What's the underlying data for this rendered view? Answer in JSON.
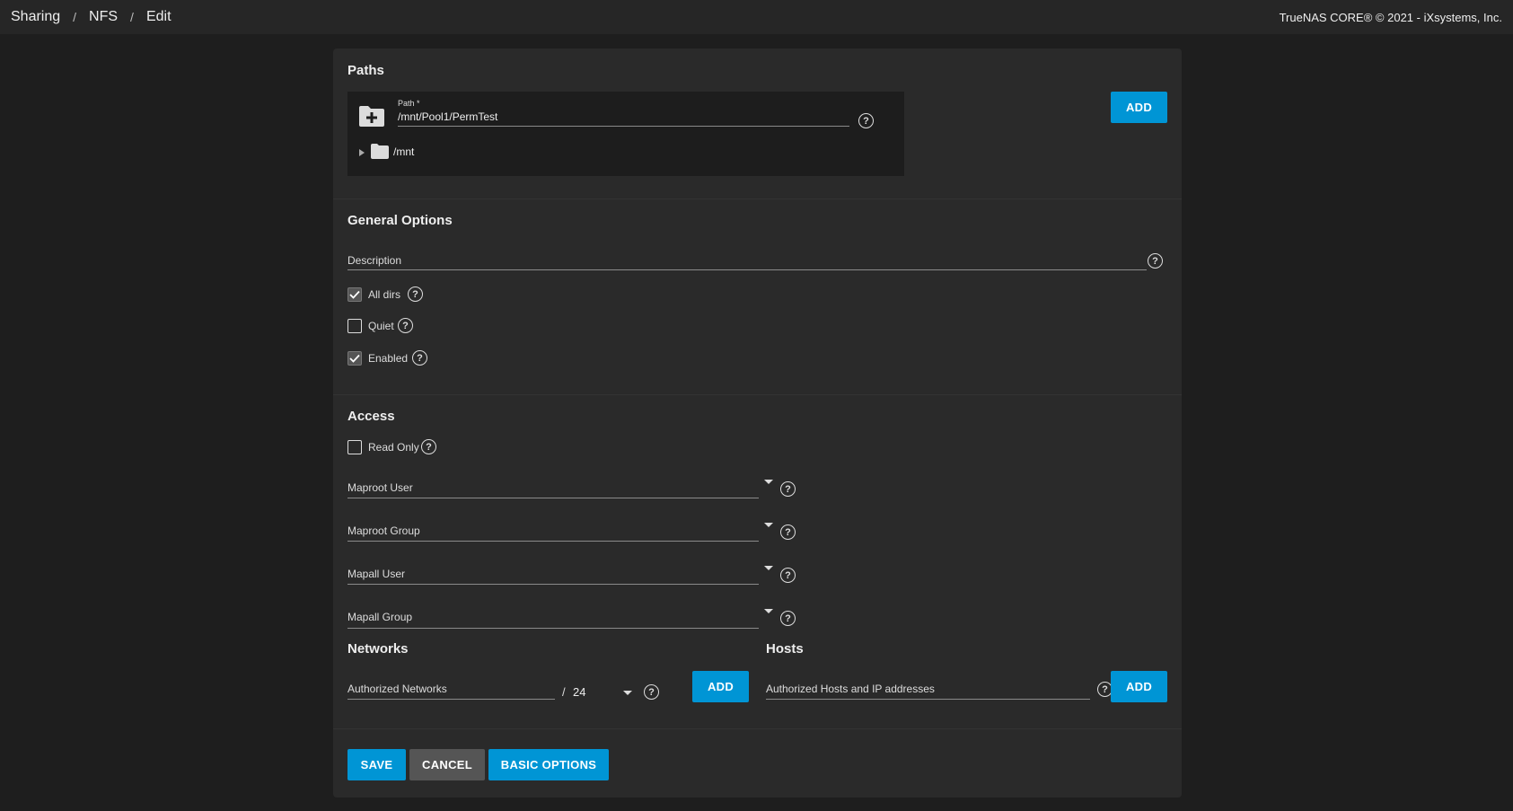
{
  "breadcrumb": {
    "items": [
      "Sharing",
      "NFS",
      "Edit"
    ],
    "separator": "/"
  },
  "copyright": "TrueNAS CORE® © 2021 - iXsystems, Inc.",
  "paths": {
    "title": "Paths",
    "path_label": "Path *",
    "path_value": "/mnt/Pool1/PermTest",
    "tree_root": "/mnt",
    "add_label": "ADD"
  },
  "general": {
    "title": "General Options",
    "description_label": "Description",
    "all_dirs_label": "All dirs",
    "all_dirs_checked": true,
    "quiet_label": "Quiet",
    "quiet_checked": false,
    "enabled_label": "Enabled",
    "enabled_checked": true
  },
  "access": {
    "title": "Access",
    "read_only_label": "Read Only",
    "read_only_checked": false,
    "maproot_user_label": "Maproot User",
    "maproot_group_label": "Maproot Group",
    "mapall_user_label": "Mapall User",
    "mapall_group_label": "Mapall Group"
  },
  "networks": {
    "title": "Networks",
    "field_label": "Authorized Networks",
    "slash": "/",
    "netmask": "24",
    "add_label": "ADD"
  },
  "hosts": {
    "title": "Hosts",
    "field_label": "Authorized Hosts and IP addresses",
    "add_label": "ADD"
  },
  "actions": {
    "save_label": "SAVE",
    "cancel_label": "CANCEL",
    "basic_label": "BASIC OPTIONS"
  },
  "colors": {
    "accent": "#0095d5",
    "background": "#1e1e1e",
    "card": "#2a2a2a"
  }
}
